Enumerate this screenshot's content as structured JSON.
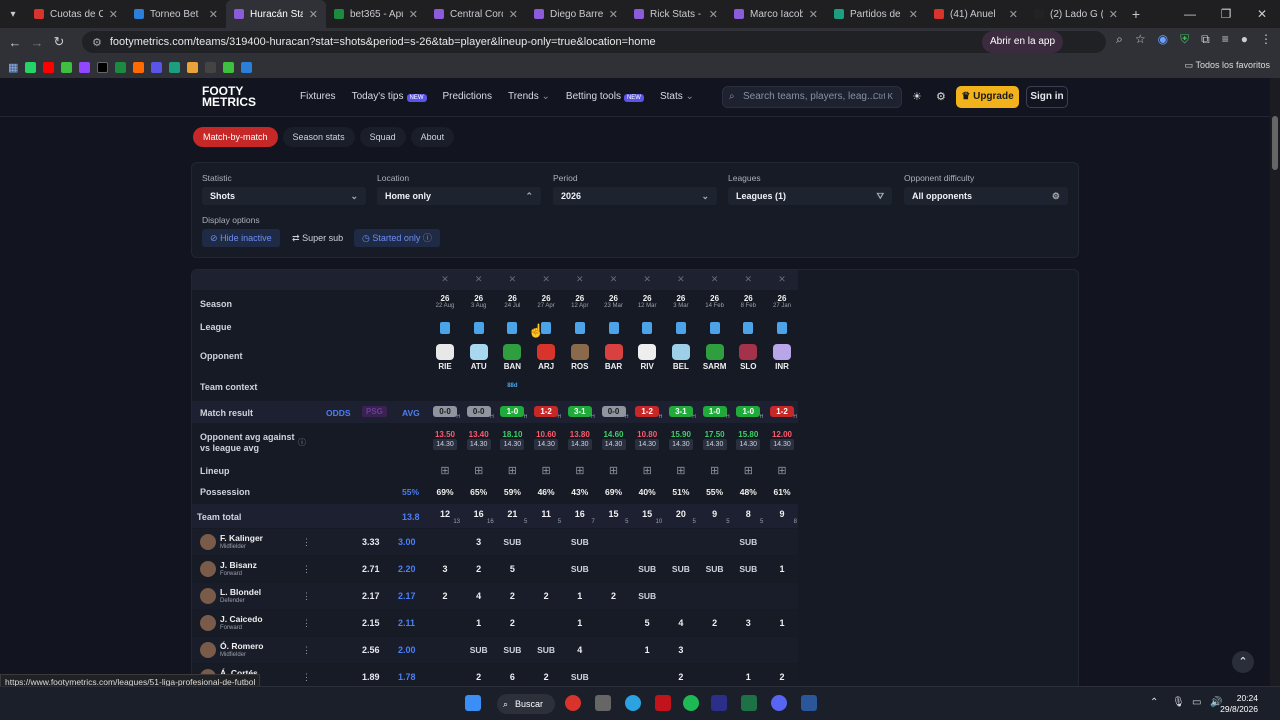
{
  "browser": {
    "tabs": [
      {
        "title": "Cuotas de CA",
        "color": "#d9342b"
      },
      {
        "title": "Torneo Bet",
        "color": "#2b7fd9"
      },
      {
        "title": "Huracán Stats",
        "color": "#8c5bd9",
        "active": true
      },
      {
        "title": "bet365 - Apue",
        "color": "#1c8a3f"
      },
      {
        "title": "Central Cordo",
        "color": "#8c5bd9"
      },
      {
        "title": "Diego Barrera",
        "color": "#8c5bd9"
      },
      {
        "title": "Rick Stats - xG",
        "color": "#8c5bd9"
      },
      {
        "title": "Marco Iacobell",
        "color": "#8c5bd9"
      },
      {
        "title": "Partidos de Fú",
        "color": "#1c9f7e"
      },
      {
        "title": "(41) Anuel",
        "color": "#d9342b"
      },
      {
        "title": "(2) Lado G (@",
        "color": "#222222"
      }
    ],
    "url": "footymetrics.com/teams/319400-huracan?stat=shots&period=s-26&tab=player&lineup-only=true&location=home",
    "open_in_app": "Abrir en la app",
    "bookmarks_folder": "Todos los favoritos"
  },
  "site": {
    "logo_line1": "FOOTY",
    "logo_line2": "METRICS",
    "nav": [
      "Fixtures",
      "Today's tips",
      "Predictions",
      "Trends",
      "Betting tools",
      "Stats"
    ],
    "new_badge": "NEW",
    "search_placeholder": "Search teams, players, leag...",
    "search_shortcut": "Ctrl K",
    "upgrade": "Upgrade",
    "signin": "Sign in"
  },
  "subtabs": [
    "Match-by-match",
    "Season stats",
    "Squad",
    "About"
  ],
  "filters": {
    "statistic_label": "Statistic",
    "statistic_value": "Shots",
    "location_label": "Location",
    "location_value": "Home only",
    "period_label": "Period",
    "period_value": "2026",
    "leagues_label": "Leagues",
    "leagues_value": "Leagues (1)",
    "opp_label": "Opponent difficulty",
    "opp_value": "All opponents",
    "display_label": "Display options",
    "hide_inactive": "Hide inactive",
    "super_sub": "Super sub",
    "started_only": "Started only"
  },
  "table": {
    "row_labels": {
      "season": "Season",
      "league": "League",
      "opponent": "Opponent",
      "context": "Team context",
      "result": "Match result",
      "opp_avg": "Opponent avg against",
      "opp_avg2": "vs league avg",
      "lineup": "Lineup",
      "possession": "Possession",
      "team_total": "Team total"
    },
    "odds_cols": [
      "ODDS",
      "PSG",
      "AVG"
    ],
    "context_tag": "88d",
    "possession_avg": "55%",
    "team_total_avg": "13.8",
    "matches": [
      {
        "season": "26",
        "date": "22 Aug",
        "opp": "RIE",
        "crest": "#e8e8e8",
        "result": "0-0",
        "res": "d",
        "oppavg": "13.50",
        "lgavg": "14.30",
        "poss": "69%",
        "total": "12",
        "sub": "13"
      },
      {
        "season": "26",
        "date": "3 Aug",
        "opp": "ATU",
        "crest": "#a8d8f0",
        "result": "0-0",
        "res": "d",
        "oppavg": "13.40",
        "lgavg": "14.30",
        "poss": "65%",
        "total": "16",
        "sub": "16"
      },
      {
        "season": "26",
        "date": "24 Jul",
        "opp": "BAN",
        "crest": "#2e9e3e",
        "result": "1-0",
        "res": "w",
        "oppavg": "18.10",
        "lgavg": "14.30",
        "poss": "59%",
        "total": "21",
        "sub": "5"
      },
      {
        "season": "26",
        "date": "27 Apr",
        "opp": "ARJ",
        "crest": "#d9342b",
        "result": "1-2",
        "res": "l",
        "oppavg": "10.60",
        "lgavg": "14.30",
        "poss": "46%",
        "total": "11",
        "sub": "5"
      },
      {
        "season": "26",
        "date": "12 Apr",
        "opp": "ROS",
        "crest": "#8a6a4a",
        "result": "3-1",
        "res": "w",
        "oppavg": "13.80",
        "lgavg": "14.30",
        "poss": "43%",
        "total": "16",
        "sub": "7"
      },
      {
        "season": "26",
        "date": "23 Mar",
        "opp": "BAR",
        "crest": "#d94040",
        "result": "0-0",
        "res": "d",
        "oppavg": "14.60",
        "lgavg": "14.30",
        "poss": "69%",
        "total": "15",
        "sub": "5"
      },
      {
        "season": "26",
        "date": "12 Mar",
        "opp": "RIV",
        "crest": "#eeeeee",
        "result": "1-2",
        "res": "l",
        "oppavg": "10.80",
        "lgavg": "14.30",
        "poss": "40%",
        "total": "15",
        "sub": "10"
      },
      {
        "season": "26",
        "date": "3 Mar",
        "opp": "BEL",
        "crest": "#9ecfe8",
        "result": "3-1",
        "res": "w",
        "oppavg": "15.90",
        "lgavg": "14.30",
        "poss": "51%",
        "total": "20",
        "sub": "5"
      },
      {
        "season": "26",
        "date": "14 Feb",
        "opp": "SARM",
        "crest": "#2e9e3e",
        "result": "1-0",
        "res": "w",
        "oppavg": "17.50",
        "lgavg": "14.30",
        "poss": "55%",
        "total": "9",
        "sub": "5"
      },
      {
        "season": "26",
        "date": "8 Feb",
        "opp": "SLO",
        "crest": "#a3324a",
        "result": "1-0",
        "res": "w",
        "oppavg": "15.80",
        "lgavg": "14.30",
        "poss": "48%",
        "total": "8",
        "sub": "5"
      },
      {
        "season": "26",
        "date": "27 Jan",
        "opp": "INR",
        "crest": "#b9a6e8",
        "result": "1-2",
        "res": "l",
        "oppavg": "12.00",
        "lgavg": "14.30",
        "poss": "61%",
        "total": "9",
        "sub": "8"
      }
    ],
    "players": [
      {
        "name": "F. Kalinger",
        "role": "Midfielder",
        "avg": "3.33",
        "pavg": "3.00",
        "vals": [
          "",
          "3",
          "SUB",
          "",
          "SUB",
          "",
          "",
          "",
          "",
          "SUB",
          ""
        ]
      },
      {
        "name": "J. Bisanz",
        "role": "Forward",
        "avg": "2.71",
        "pavg": "2.20",
        "vals": [
          "3",
          "2",
          "5",
          "",
          "SUB",
          "",
          "SUB",
          "SUB",
          "SUB",
          "SUB",
          "1"
        ]
      },
      {
        "name": "L. Blondel",
        "role": "Defender",
        "avg": "2.17",
        "pavg": "2.17",
        "vals": [
          "2",
          "4",
          "2",
          "2",
          "1",
          "2",
          "SUB",
          "",
          "",
          "",
          ""
        ]
      },
      {
        "name": "J. Caicedo",
        "role": "Forward",
        "avg": "2.15",
        "pavg": "2.11",
        "vals": [
          "",
          "1",
          "2",
          "",
          "1",
          "",
          "5",
          "4",
          "2",
          "3",
          "1"
        ]
      },
      {
        "name": "Ó. Romero",
        "role": "Midfielder",
        "avg": "2.56",
        "pavg": "2.00",
        "vals": [
          "",
          "SUB",
          "SUB",
          "SUB",
          "4",
          "",
          "1",
          "3",
          "",
          "",
          ""
        ]
      },
      {
        "name": "Á. Cortés",
        "role": "",
        "avg": "1.89",
        "pavg": "1.78",
        "vals": [
          "",
          "2",
          "6",
          "2",
          "SUB",
          "",
          "",
          "2",
          "",
          "1",
          "2"
        ]
      }
    ]
  },
  "status_url": "https://www.footymetrics.com/leagues/51-liga-profesional-de-futbol",
  "taskbar": {
    "search": "Buscar",
    "time": "20:24",
    "date": "29/8/2026"
  }
}
